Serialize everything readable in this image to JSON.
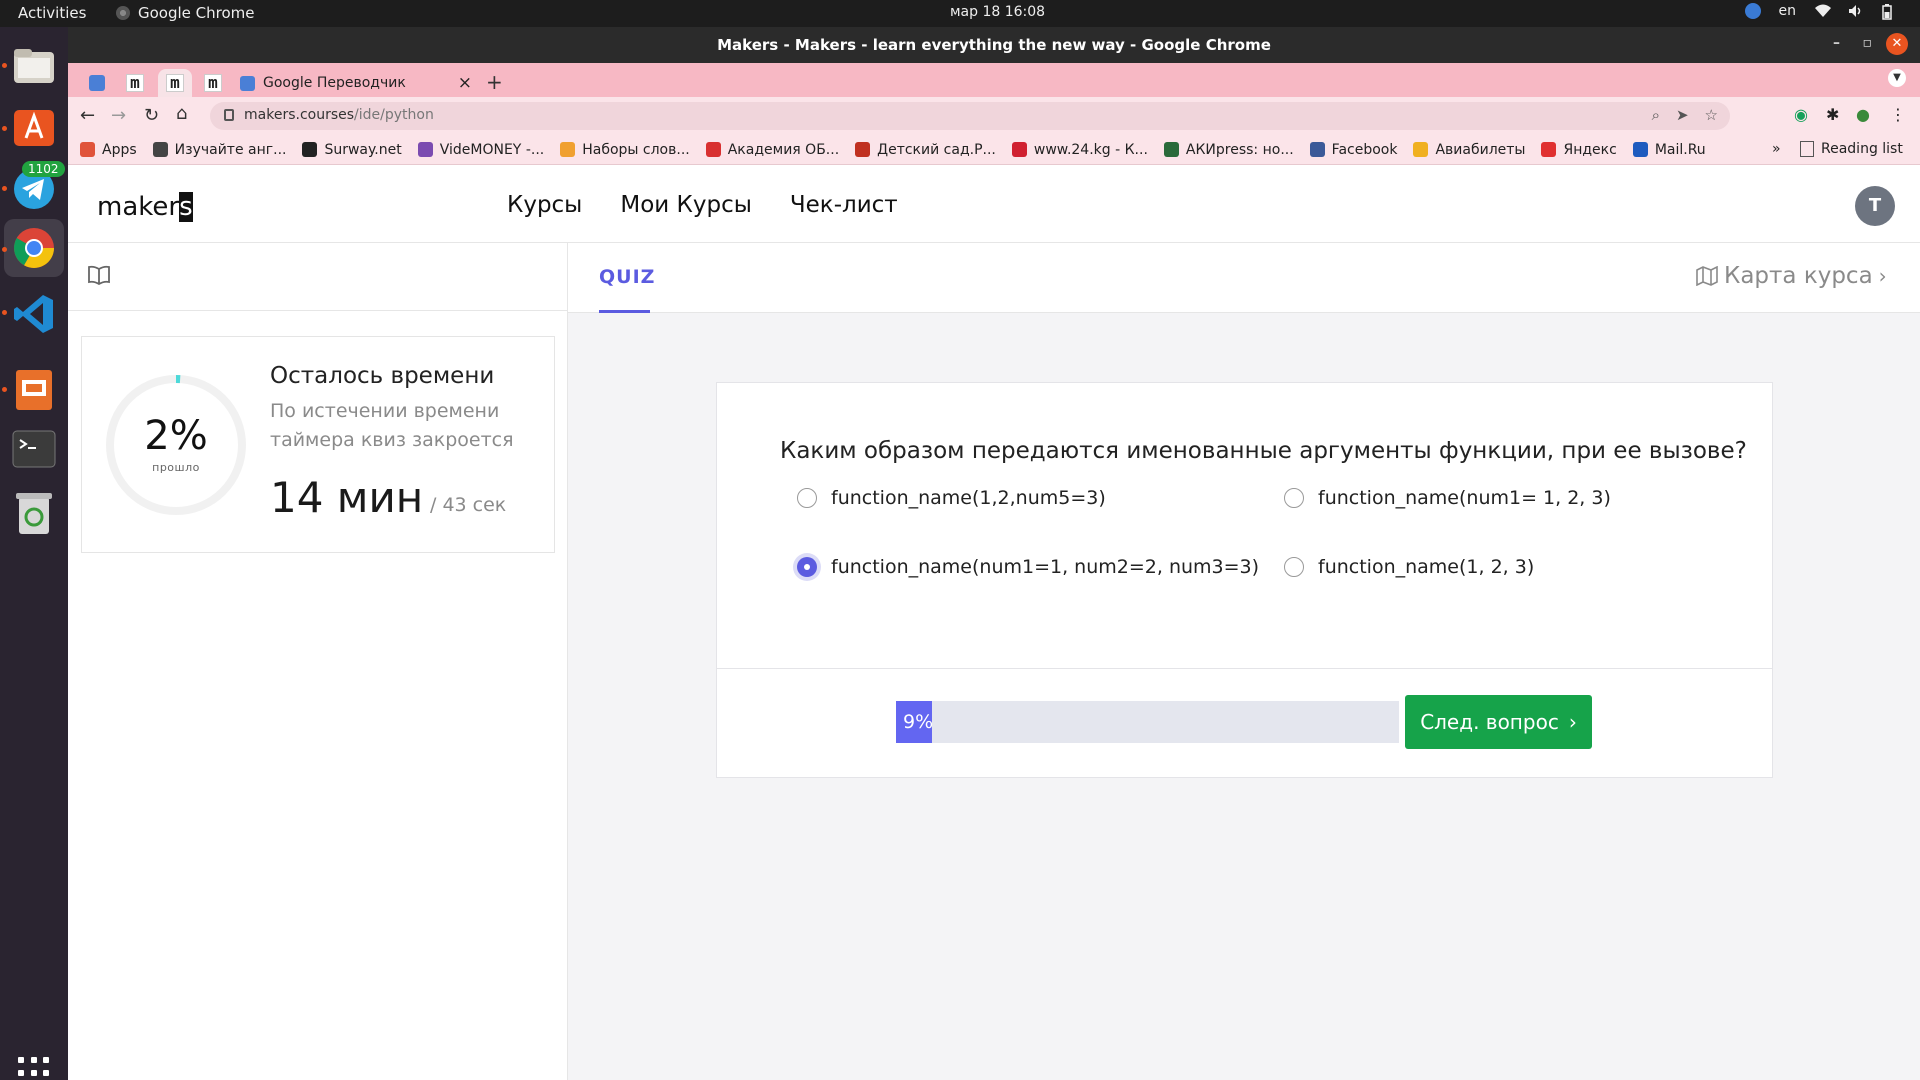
{
  "system": {
    "activities": "Activities",
    "app_name": "Google Chrome",
    "clock": "мар 18  16:08",
    "lang": "en",
    "dock_badge": "1102"
  },
  "window": {
    "title": "Makers - Makers - learn everything the new way - Google Chrome"
  },
  "tabs": [
    {
      "label": "m"
    },
    {
      "label": "m"
    },
    {
      "label": "m"
    },
    {
      "label": "Google Переводчик"
    }
  ],
  "tab_close": "×",
  "new_tab": "+",
  "address": {
    "host": "makers.courses",
    "path": "/ide/python"
  },
  "bookmarks": [
    {
      "label": "Apps",
      "color": "#e0533a"
    },
    {
      "label": "Изучайте анг...",
      "color": "#444444"
    },
    {
      "label": "Surway.net",
      "color": "#222222"
    },
    {
      "label": "VideMONEY -...",
      "color": "#7b4bb0"
    },
    {
      "label": "Наборы слов...",
      "color": "#f0a030"
    },
    {
      "label": "Академия ОБ...",
      "color": "#d83030"
    },
    {
      "label": "Детский сад.Р...",
      "color": "#c03020"
    },
    {
      "label": "www.24.kg - К...",
      "color": "#d02030"
    },
    {
      "label": "АКИpress: но...",
      "color": "#2a6a3a"
    },
    {
      "label": "Facebook",
      "color": "#3b5998"
    },
    {
      "label": "Авиабилеты",
      "color": "#f0b020"
    },
    {
      "label": "Яндекс",
      "color": "#e03030"
    },
    {
      "label": "Mail.Ru",
      "color": "#1e5bbf"
    }
  ],
  "bookmarks_more": "»",
  "reading_list": "Reading list",
  "site": {
    "logo_main": "maker",
    "logo_cursor": "s",
    "nav": [
      "Курсы",
      "Мои Курсы",
      "Чек-лист"
    ],
    "avatar": "T"
  },
  "timer": {
    "percent": "2%",
    "percent_label": "прошло",
    "progress_fraction": 0.02,
    "title": "Осталось времени",
    "description": "По истечении времени таймера квиз закроется",
    "minutes": "14 мин",
    "seconds": "/ 43 сек"
  },
  "quiz": {
    "tab": "QUIZ",
    "course_map": "Карта курса",
    "question": "Каким образом передаются именованные аргументы функции, при ее вызове?",
    "options": [
      "function_name(1,2,num5=3)",
      "function_name(num1= 1, 2, 3)",
      "function_name(num1=1, num2=2, num3=3)",
      "function_name(1, 2, 3)"
    ],
    "selected_index": 2,
    "progress_label": "9%",
    "progress_fraction": 0.09,
    "next_button": "След. вопрос"
  },
  "colors": {
    "accent": "#5b5be0",
    "progress": "#6366f1",
    "next_button": "#16a34a",
    "tabstrip": "#f7b8c4"
  }
}
